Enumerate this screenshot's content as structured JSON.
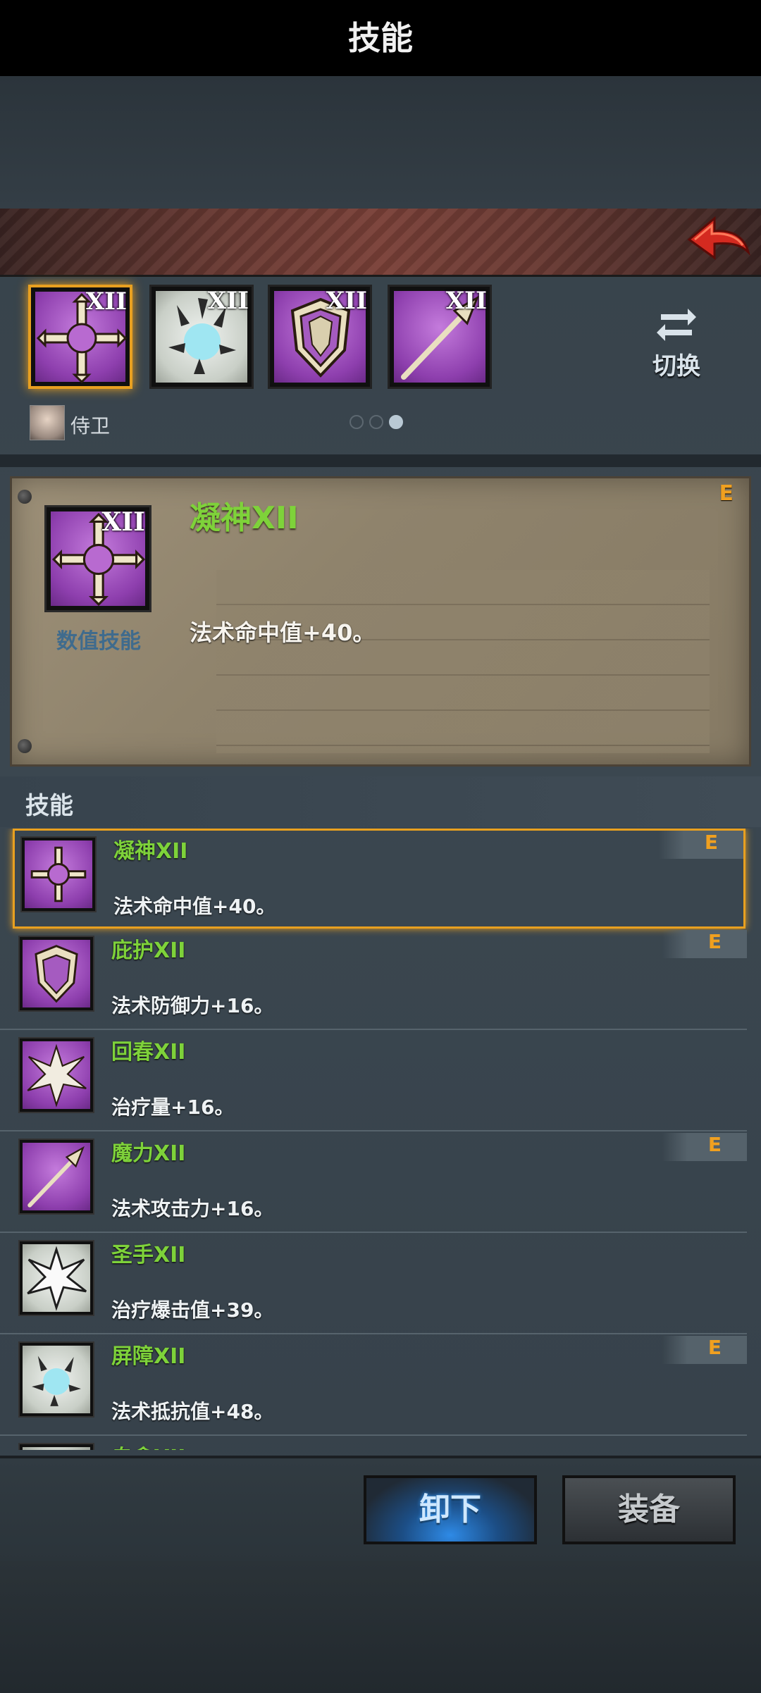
{
  "header": {
    "title": "技能"
  },
  "slots": [
    {
      "roman": "XII",
      "style": "purple",
      "icon": "cross-sigil-icon",
      "selected": true
    },
    {
      "roman": "XII",
      "style": "pale",
      "icon": "shatter-burst-icon",
      "selected": false
    },
    {
      "roman": "XII",
      "style": "purple",
      "icon": "shield-icon",
      "selected": false
    },
    {
      "roman": "XII",
      "style": "purple",
      "icon": "spear-icon",
      "selected": false
    }
  ],
  "switch": {
    "label": "切换",
    "icon": "swap-arrows-icon"
  },
  "role": {
    "name": "侍卫",
    "avatar": "portrait-avatar"
  },
  "pagination": {
    "total": 3,
    "active_index": 2
  },
  "detail": {
    "name": "凝神XII",
    "roman": "XII",
    "type_label": "数值技能",
    "grade": "E",
    "description": "法术命中值+40。",
    "icon": "cross-sigil-icon"
  },
  "list_section": {
    "label": "技能"
  },
  "skills": [
    {
      "name": "凝神XII",
      "description": "法术命中值+40。",
      "grade": "E",
      "icon": "cross-sigil-icon",
      "style": "purple",
      "selected": true
    },
    {
      "name": "庇护XII",
      "description": "法术防御力+16。",
      "grade": "E",
      "icon": "shield-icon",
      "style": "purple",
      "selected": false
    },
    {
      "name": "回春XII",
      "description": "治疗量+16。",
      "grade": "",
      "icon": "burst-icon",
      "style": "purple",
      "selected": false
    },
    {
      "name": "魔力XII",
      "description": "法术攻击力+16。",
      "grade": "E",
      "icon": "spear-icon",
      "style": "purple",
      "selected": false
    },
    {
      "name": "圣手XII",
      "description": "治疗爆击值+39。",
      "grade": "",
      "icon": "burst-icon",
      "style": "pale",
      "selected": false
    },
    {
      "name": "屏障XII",
      "description": "法术抵抗值+48。",
      "grade": "E",
      "icon": "shatter-burst-icon",
      "style": "pale",
      "selected": false
    },
    {
      "name": "自愈XII",
      "description": "",
      "grade": "",
      "icon": "scroll-icon",
      "style": "pale",
      "selected": false
    }
  ],
  "buttons": {
    "unequip": "卸下",
    "equip": "装备"
  },
  "colors": {
    "accent_gold": "#e8a020",
    "skill_name_green": "#7ed23a",
    "grade_orange": "#f0a020"
  }
}
